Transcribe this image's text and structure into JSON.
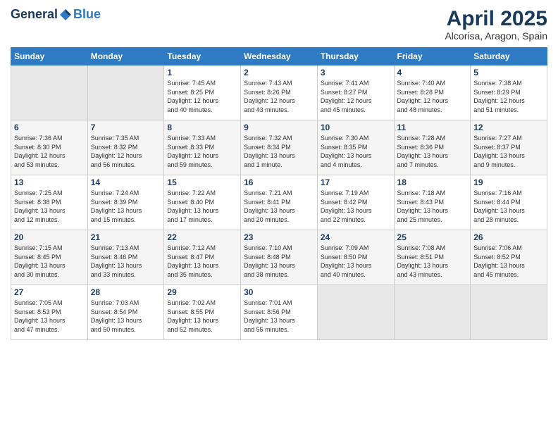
{
  "header": {
    "logo_general": "General",
    "logo_blue": "Blue",
    "month_title": "April 2025",
    "location": "Alcorisa, Aragon, Spain"
  },
  "columns": [
    "Sunday",
    "Monday",
    "Tuesday",
    "Wednesday",
    "Thursday",
    "Friday",
    "Saturday"
  ],
  "weeks": [
    [
      {
        "day": "",
        "content": ""
      },
      {
        "day": "",
        "content": ""
      },
      {
        "day": "1",
        "content": "Sunrise: 7:45 AM\nSunset: 8:25 PM\nDaylight: 12 hours\nand 40 minutes."
      },
      {
        "day": "2",
        "content": "Sunrise: 7:43 AM\nSunset: 8:26 PM\nDaylight: 12 hours\nand 43 minutes."
      },
      {
        "day": "3",
        "content": "Sunrise: 7:41 AM\nSunset: 8:27 PM\nDaylight: 12 hours\nand 45 minutes."
      },
      {
        "day": "4",
        "content": "Sunrise: 7:40 AM\nSunset: 8:28 PM\nDaylight: 12 hours\nand 48 minutes."
      },
      {
        "day": "5",
        "content": "Sunrise: 7:38 AM\nSunset: 8:29 PM\nDaylight: 12 hours\nand 51 minutes."
      }
    ],
    [
      {
        "day": "6",
        "content": "Sunrise: 7:36 AM\nSunset: 8:30 PM\nDaylight: 12 hours\nand 53 minutes."
      },
      {
        "day": "7",
        "content": "Sunrise: 7:35 AM\nSunset: 8:32 PM\nDaylight: 12 hours\nand 56 minutes."
      },
      {
        "day": "8",
        "content": "Sunrise: 7:33 AM\nSunset: 8:33 PM\nDaylight: 12 hours\nand 59 minutes."
      },
      {
        "day": "9",
        "content": "Sunrise: 7:32 AM\nSunset: 8:34 PM\nDaylight: 13 hours\nand 1 minute."
      },
      {
        "day": "10",
        "content": "Sunrise: 7:30 AM\nSunset: 8:35 PM\nDaylight: 13 hours\nand 4 minutes."
      },
      {
        "day": "11",
        "content": "Sunrise: 7:28 AM\nSunset: 8:36 PM\nDaylight: 13 hours\nand 7 minutes."
      },
      {
        "day": "12",
        "content": "Sunrise: 7:27 AM\nSunset: 8:37 PM\nDaylight: 13 hours\nand 9 minutes."
      }
    ],
    [
      {
        "day": "13",
        "content": "Sunrise: 7:25 AM\nSunset: 8:38 PM\nDaylight: 13 hours\nand 12 minutes."
      },
      {
        "day": "14",
        "content": "Sunrise: 7:24 AM\nSunset: 8:39 PM\nDaylight: 13 hours\nand 15 minutes."
      },
      {
        "day": "15",
        "content": "Sunrise: 7:22 AM\nSunset: 8:40 PM\nDaylight: 13 hours\nand 17 minutes."
      },
      {
        "day": "16",
        "content": "Sunrise: 7:21 AM\nSunset: 8:41 PM\nDaylight: 13 hours\nand 20 minutes."
      },
      {
        "day": "17",
        "content": "Sunrise: 7:19 AM\nSunset: 8:42 PM\nDaylight: 13 hours\nand 22 minutes."
      },
      {
        "day": "18",
        "content": "Sunrise: 7:18 AM\nSunset: 8:43 PM\nDaylight: 13 hours\nand 25 minutes."
      },
      {
        "day": "19",
        "content": "Sunrise: 7:16 AM\nSunset: 8:44 PM\nDaylight: 13 hours\nand 28 minutes."
      }
    ],
    [
      {
        "day": "20",
        "content": "Sunrise: 7:15 AM\nSunset: 8:45 PM\nDaylight: 13 hours\nand 30 minutes."
      },
      {
        "day": "21",
        "content": "Sunrise: 7:13 AM\nSunset: 8:46 PM\nDaylight: 13 hours\nand 33 minutes."
      },
      {
        "day": "22",
        "content": "Sunrise: 7:12 AM\nSunset: 8:47 PM\nDaylight: 13 hours\nand 35 minutes."
      },
      {
        "day": "23",
        "content": "Sunrise: 7:10 AM\nSunset: 8:48 PM\nDaylight: 13 hours\nand 38 minutes."
      },
      {
        "day": "24",
        "content": "Sunrise: 7:09 AM\nSunset: 8:50 PM\nDaylight: 13 hours\nand 40 minutes."
      },
      {
        "day": "25",
        "content": "Sunrise: 7:08 AM\nSunset: 8:51 PM\nDaylight: 13 hours\nand 43 minutes."
      },
      {
        "day": "26",
        "content": "Sunrise: 7:06 AM\nSunset: 8:52 PM\nDaylight: 13 hours\nand 45 minutes."
      }
    ],
    [
      {
        "day": "27",
        "content": "Sunrise: 7:05 AM\nSunset: 8:53 PM\nDaylight: 13 hours\nand 47 minutes."
      },
      {
        "day": "28",
        "content": "Sunrise: 7:03 AM\nSunset: 8:54 PM\nDaylight: 13 hours\nand 50 minutes."
      },
      {
        "day": "29",
        "content": "Sunrise: 7:02 AM\nSunset: 8:55 PM\nDaylight: 13 hours\nand 52 minutes."
      },
      {
        "day": "30",
        "content": "Sunrise: 7:01 AM\nSunset: 8:56 PM\nDaylight: 13 hours\nand 55 minutes."
      },
      {
        "day": "",
        "content": ""
      },
      {
        "day": "",
        "content": ""
      },
      {
        "day": "",
        "content": ""
      }
    ]
  ]
}
